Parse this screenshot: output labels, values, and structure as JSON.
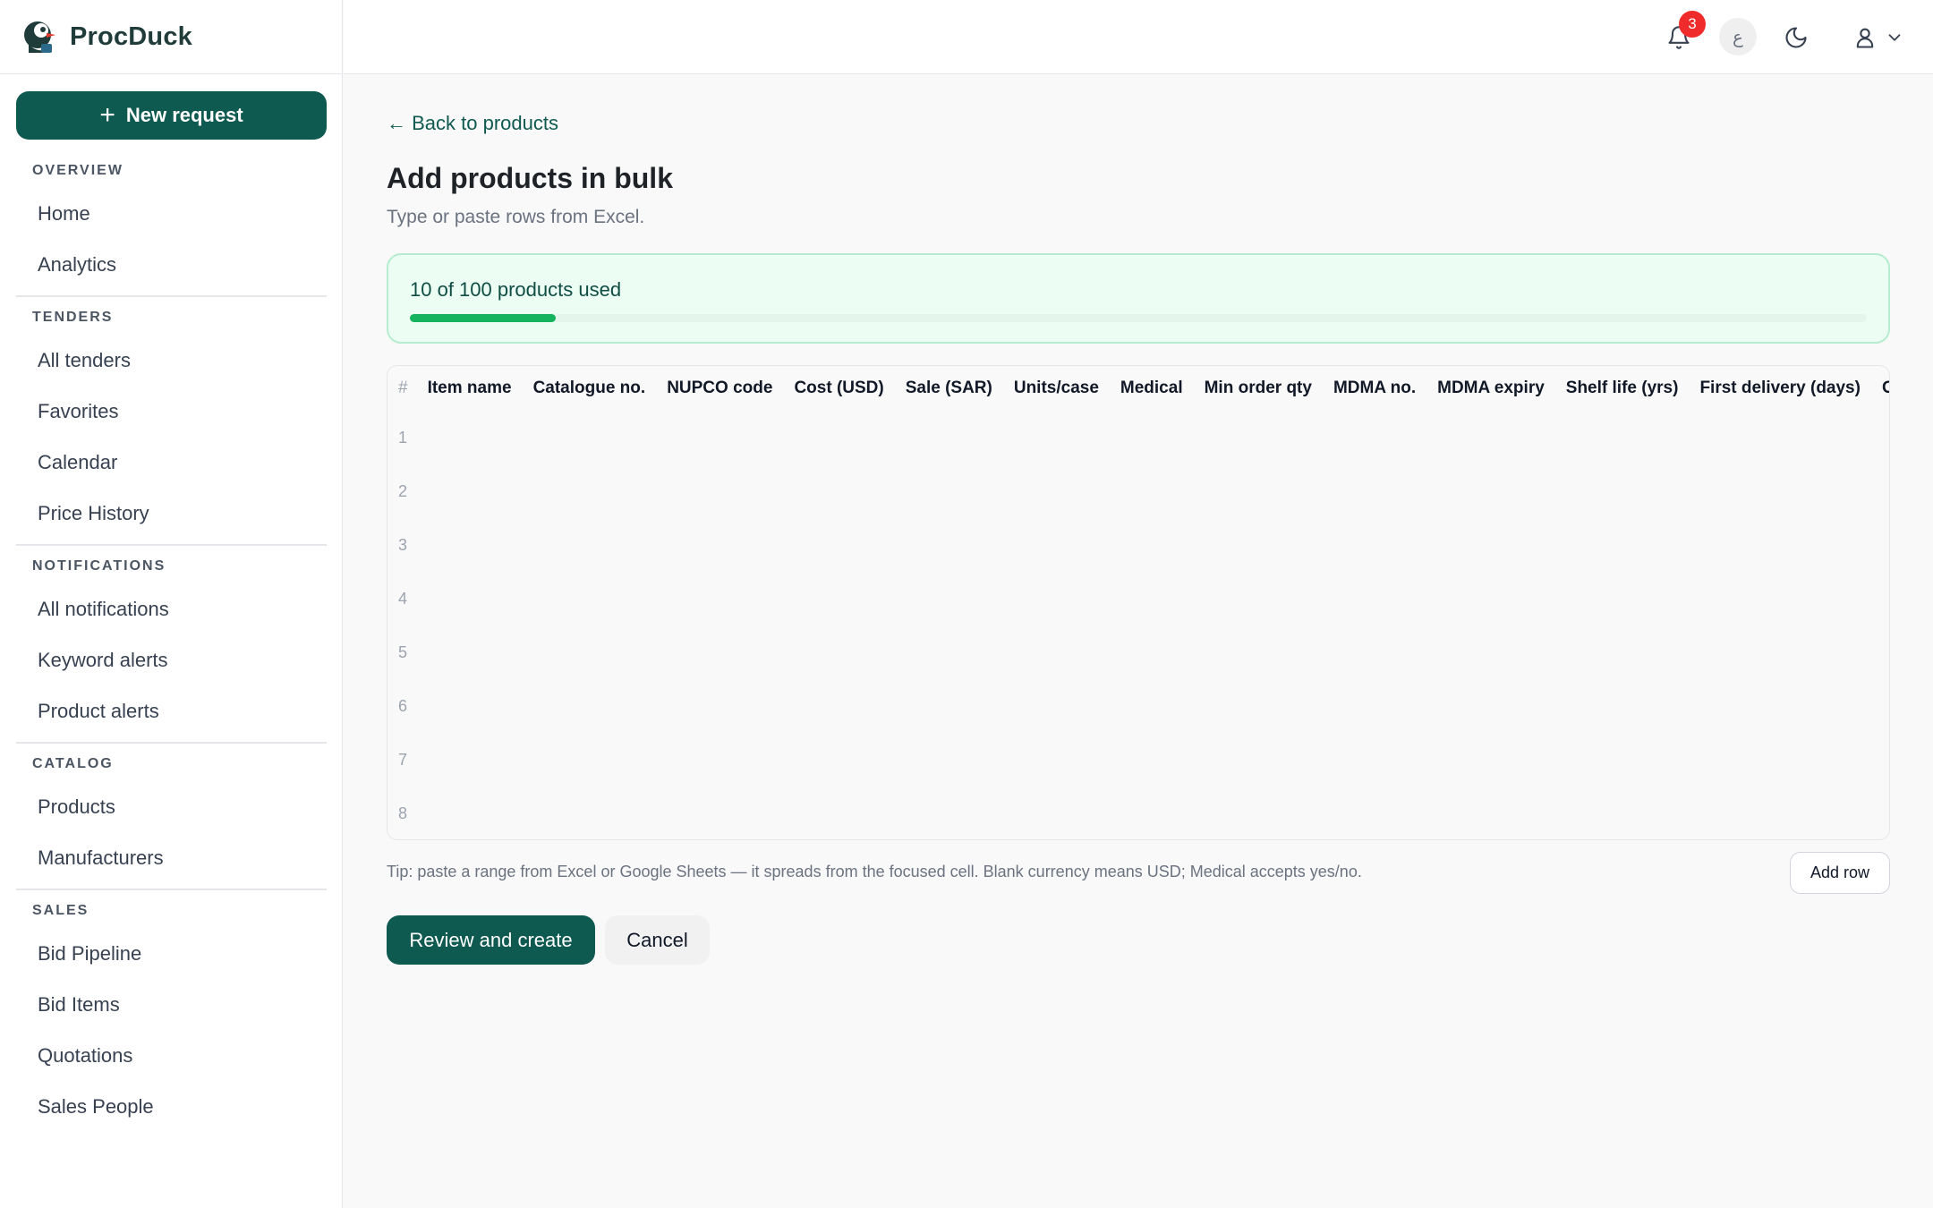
{
  "brand": {
    "name": "ProcDuck",
    "logo_icon": "duck-logo-icon"
  },
  "sidebar": {
    "new_request_label": "New request",
    "sections": [
      {
        "title": "OVERVIEW",
        "items": [
          "Home",
          "Analytics"
        ]
      },
      {
        "title": "TENDERS",
        "items": [
          "All tenders",
          "Favorites",
          "Calendar",
          "Price History"
        ]
      },
      {
        "title": "NOTIFICATIONS",
        "items": [
          "All notifications",
          "Keyword alerts",
          "Product alerts"
        ]
      },
      {
        "title": "CATALOG",
        "items": [
          "Products",
          "Manufacturers"
        ]
      },
      {
        "title": "SALES",
        "items": [
          "Bid Pipeline",
          "Bid Items",
          "Quotations",
          "Sales People"
        ]
      }
    ]
  },
  "topbar": {
    "notification_count": "3",
    "language_glyph": "ع",
    "icons": [
      "bell-icon",
      "language-icon",
      "moon-icon",
      "user-icon",
      "chevron-down-icon"
    ]
  },
  "main": {
    "back_label": "← Back to products",
    "title": "Add products in bulk",
    "subtitle": "Type or paste rows from Excel.",
    "usage": {
      "text": "10 of 100 products used",
      "used": 10,
      "limit": 100,
      "bar_color": "#16b35e"
    },
    "grid": {
      "hash_label": "#",
      "columns": [
        "Item name",
        "Catalogue no.",
        "NUPCO code",
        "Cost (USD)",
        "Sale (SAR)",
        "Units/case",
        "Medical",
        "Min order qty",
        "MDMA no.",
        "MDMA expiry",
        "Shelf life (yrs)",
        "First delivery (days)",
        "Ord"
      ],
      "rows": [
        "1",
        "2",
        "3",
        "4",
        "5",
        "6",
        "7",
        "8"
      ]
    },
    "tip": "Tip: paste a range from Excel or Google Sheets — it spreads from the focused cell. Blank currency means USD; Medical accepts yes/no.",
    "add_row_label": "Add row",
    "review_label": "Review and create",
    "cancel_label": "Cancel"
  },
  "colors": {
    "primary": "#0f5a50",
    "badge": "#ef2b2b",
    "usage_bg": "#ecfdf3"
  }
}
